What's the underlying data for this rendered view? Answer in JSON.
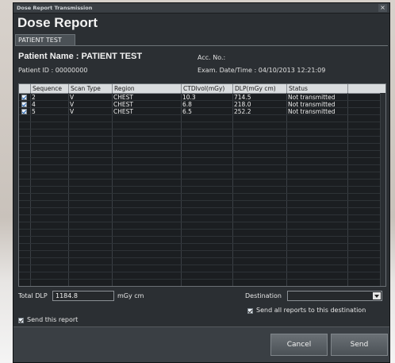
{
  "window": {
    "title": "Dose Report Transmission",
    "close_glyph": "×"
  },
  "heading": "Dose Report",
  "tab": {
    "label": "PATIENT TEST"
  },
  "patient": {
    "name": "Patient Name : PATIENT  TEST",
    "id": "Patient ID : 00000000",
    "acc": "Acc. No.:",
    "exam": "Exam. Date/Time : 04/10/2013  12:21:09"
  },
  "table": {
    "headers": [
      "Sequence",
      "Scan Type",
      "Region",
      "CTDIvol(mGy)",
      "DLP(mGy cm)",
      "Status"
    ],
    "rows": [
      {
        "sequence": "2",
        "scan_type": "V",
        "region": "CHEST",
        "ctdi": "10.3",
        "dlp": "714.5",
        "status": "Not transmitted"
      },
      {
        "sequence": "4",
        "scan_type": "V",
        "region": "CHEST",
        "ctdi": "6.8",
        "dlp": "218.0",
        "status": "Not transmitted"
      },
      {
        "sequence": "5",
        "scan_type": "V",
        "region": "CHEST",
        "ctdi": "6.5",
        "dlp": "252.2",
        "status": "Not transmitted"
      }
    ]
  },
  "total": {
    "label": "Total DLP",
    "value": "1184.8",
    "unit": "mGy cm"
  },
  "destination": {
    "label": "Destination",
    "value": ""
  },
  "send_all_label": "Send all reports to this destination",
  "send_this_label": "Send this report",
  "buttons": {
    "cancel": "Cancel",
    "send": "Send"
  },
  "colors": {
    "window_bg": "#2b2f33",
    "header_bg": "#d9dcde",
    "check_accent": "#1a5fb4"
  }
}
